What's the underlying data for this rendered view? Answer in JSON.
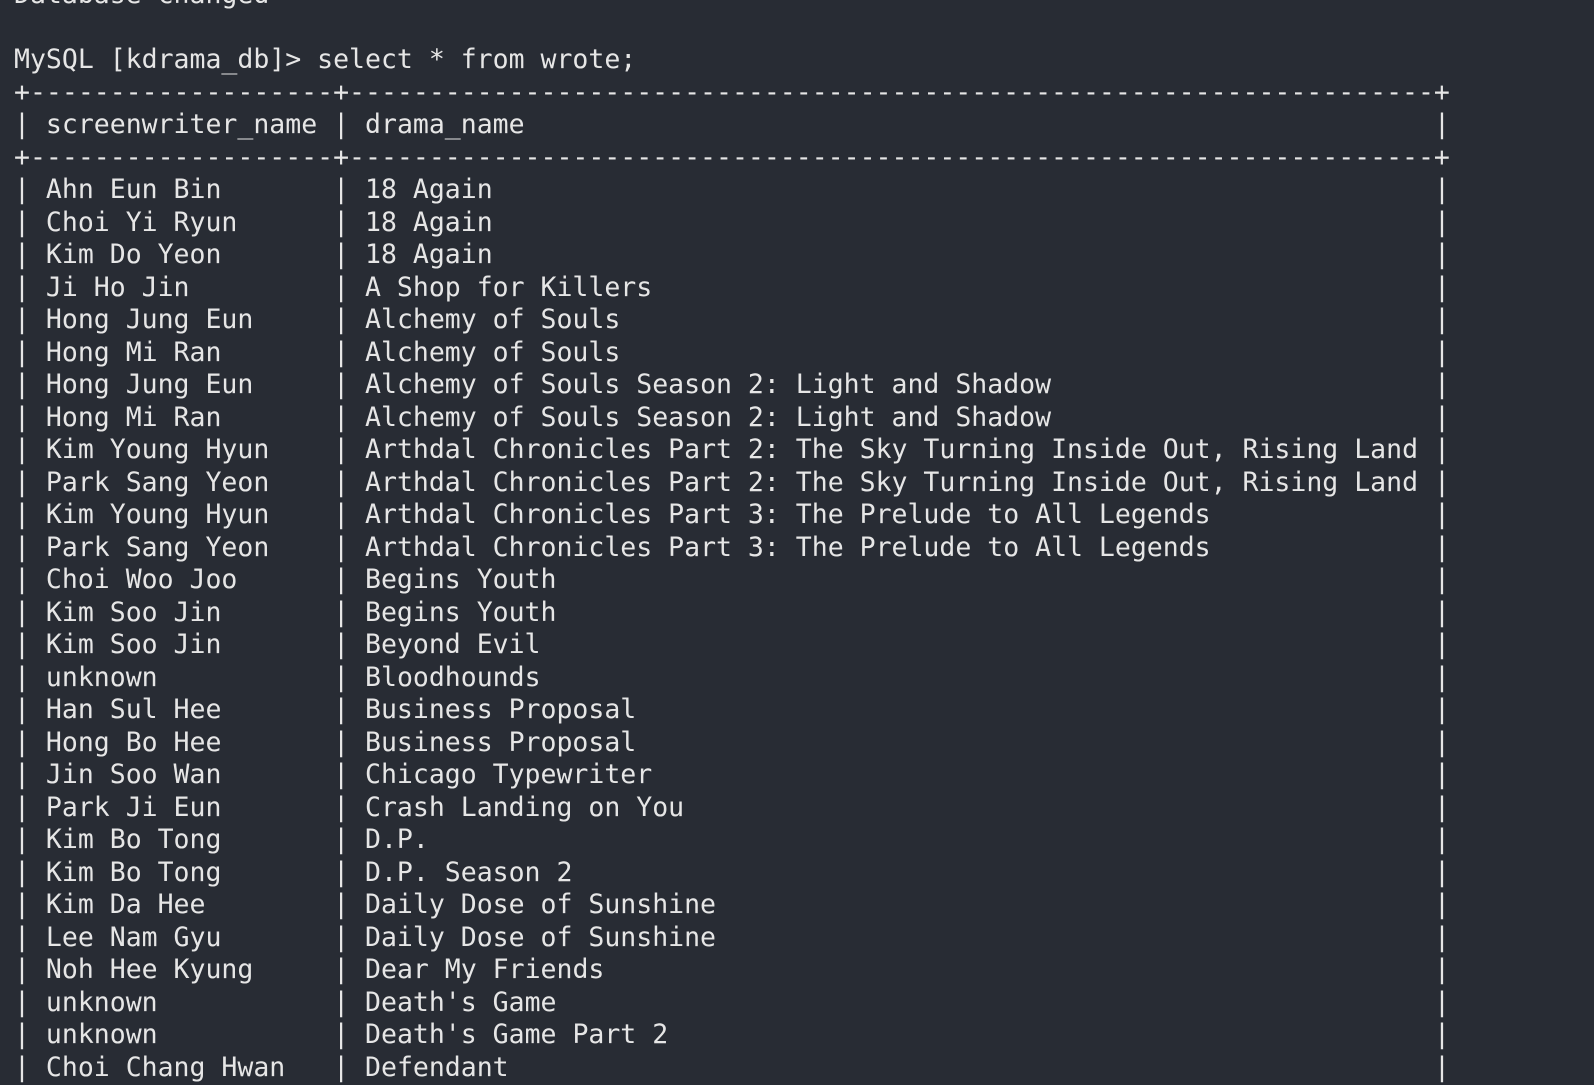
{
  "terminal": {
    "clipped_top_line": "Database changed",
    "prompt": "MySQL [kdrama_db]> ",
    "command": "select * from wrote;"
  },
  "table": {
    "columns": [
      "screenwriter_name",
      "drama_name"
    ],
    "rows": [
      [
        "Ahn Eun Bin",
        "18 Again"
      ],
      [
        "Choi Yi Ryun",
        "18 Again"
      ],
      [
        "Kim Do Yeon",
        "18 Again"
      ],
      [
        "Ji Ho Jin",
        "A Shop for Killers"
      ],
      [
        "Hong Jung Eun",
        "Alchemy of Souls"
      ],
      [
        "Hong Mi Ran",
        "Alchemy of Souls"
      ],
      [
        "Hong Jung Eun",
        "Alchemy of Souls Season 2: Light and Shadow"
      ],
      [
        "Hong Mi Ran",
        "Alchemy of Souls Season 2: Light and Shadow"
      ],
      [
        "Kim Young Hyun",
        "Arthdal Chronicles Part 2: The Sky Turning Inside Out, Rising Land"
      ],
      [
        "Park Sang Yeon",
        "Arthdal Chronicles Part 2: The Sky Turning Inside Out, Rising Land"
      ],
      [
        "Kim Young Hyun",
        "Arthdal Chronicles Part 3: The Prelude to All Legends"
      ],
      [
        "Park Sang Yeon",
        "Arthdal Chronicles Part 3: The Prelude to All Legends"
      ],
      [
        "Choi Woo Joo",
        "Begins Youth"
      ],
      [
        "Kim Soo Jin",
        "Begins Youth"
      ],
      [
        "Kim Soo Jin",
        "Beyond Evil"
      ],
      [
        "unknown",
        "Bloodhounds"
      ],
      [
        "Han Sul Hee",
        "Business Proposal"
      ],
      [
        "Hong Bo Hee",
        "Business Proposal"
      ],
      [
        "Jin Soo Wan",
        "Chicago Typewriter"
      ],
      [
        "Park Ji Eun",
        "Crash Landing on You"
      ],
      [
        "Kim Bo Tong",
        "D.P."
      ],
      [
        "Kim Bo Tong",
        "D.P. Season 2"
      ],
      [
        "Kim Da Hee",
        "Daily Dose of Sunshine"
      ],
      [
        "Lee Nam Gyu",
        "Daily Dose of Sunshine"
      ],
      [
        "Noh Hee Kyung",
        "Dear My Friends"
      ],
      [
        "unknown",
        "Death's Game"
      ],
      [
        "unknown",
        "Death's Game Part 2"
      ],
      [
        "Choi Chang Hwan",
        "Defendant"
      ]
    ]
  }
}
